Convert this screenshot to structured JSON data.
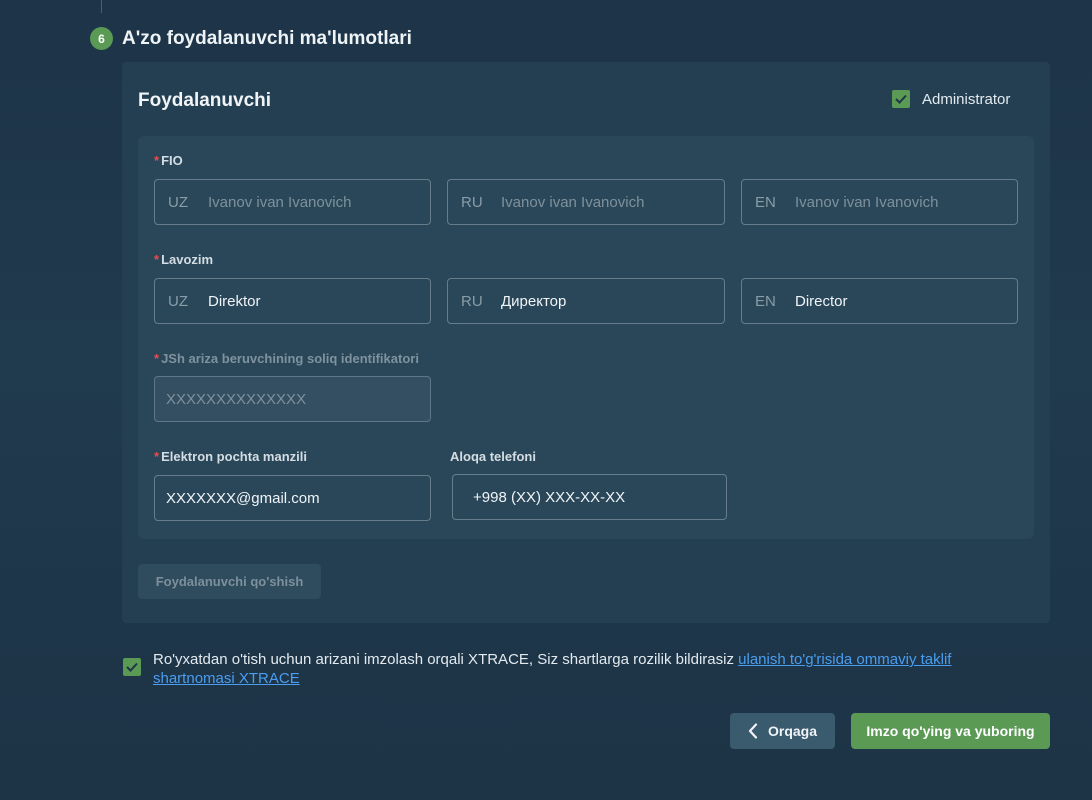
{
  "step": {
    "number": "6",
    "title": "A'zo foydalanuvchi ma'lumotlari"
  },
  "card": {
    "title": "Foydalanuvchi",
    "admin_label": "Administrator",
    "admin_checked": true
  },
  "fio": {
    "label": "FIO",
    "required": "*",
    "fields": [
      {
        "prefix": "UZ",
        "placeholder": "Ivanov ivan Ivanovich",
        "value": ""
      },
      {
        "prefix": "RU",
        "placeholder": "Ivanov ivan Ivanovich",
        "value": ""
      },
      {
        "prefix": "EN",
        "placeholder": "Ivanov ivan Ivanovich",
        "value": ""
      }
    ]
  },
  "lavozim": {
    "label": "Lavozim",
    "required": "*",
    "fields": [
      {
        "prefix": "UZ",
        "value": "Direktor"
      },
      {
        "prefix": "RU",
        "value": "Директор"
      },
      {
        "prefix": "EN",
        "value": "Director"
      }
    ]
  },
  "jsh": {
    "label": "JSh ariza beruvchining soliq identifikatori",
    "required": "*",
    "placeholder": "XXXXXXXXXXXXXX"
  },
  "email": {
    "label": "Elektron pochta manzili",
    "required": "*",
    "value": "XXXXXXX@gmail.com"
  },
  "phone": {
    "label": "Aloqa telefoni",
    "value": "+998 (XX) XXX-XX-XX"
  },
  "add_user_label": "Foydalanuvchi qo'shish",
  "agreement": {
    "checked": true,
    "text": "Ro'yxatdan o'tish uchun arizani imzolash orqali XTRACE, Siz shartlarga rozilik bildirasiz ",
    "link": "ulanish to'g'risida ommaviy taklif shartnomasi XTRACE"
  },
  "buttons": {
    "back": "Orqaga",
    "submit": "Imzo qo'ying va yuboring"
  },
  "colors": {
    "accent_green": "#5a9a55",
    "link_blue": "#4a9df0",
    "required_red": "#e05050"
  }
}
